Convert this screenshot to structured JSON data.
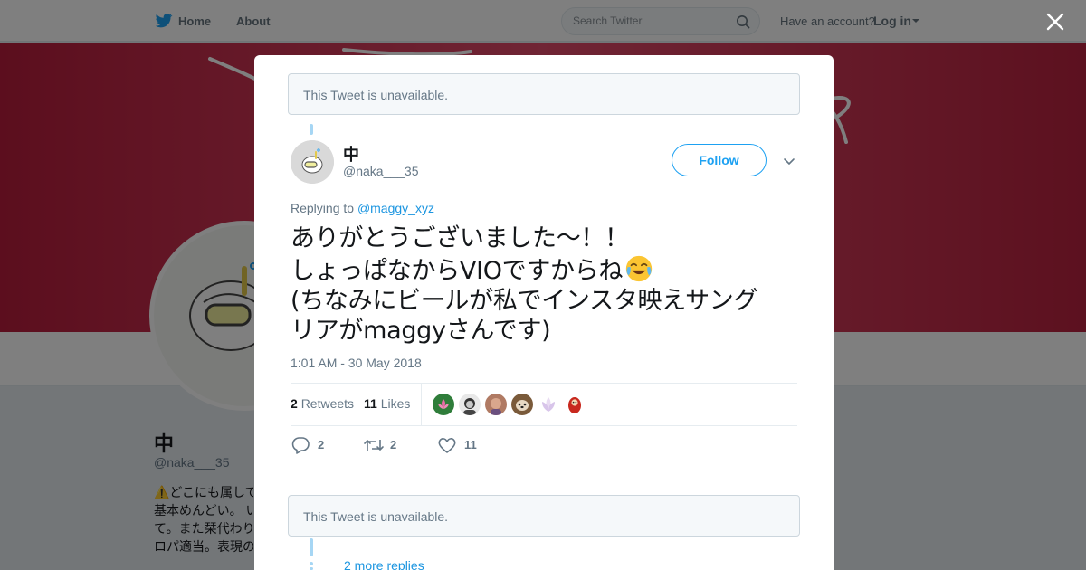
{
  "topbar": {
    "home_label": "Home",
    "about_label": "About",
    "search_placeholder": "Search Twitter",
    "account_prompt": "Have an account?",
    "login_label": "Log in"
  },
  "profile": {
    "name": "中",
    "handle": "@naka___35",
    "bio_lines": [
      "⚠️どこにも属して",
      "基本めんどい。 い",
      "て。また栞代わり",
      "ロパ適当。表現の"
    ]
  },
  "modal": {
    "unavailable_top": "This Tweet is unavailable.",
    "unavailable_bottom": "This Tweet is unavailable.",
    "more_replies": "2 more replies"
  },
  "tweet": {
    "author_name": "中",
    "author_handle": "@naka___35",
    "follow_label": "Follow",
    "replying_prefix": "Replying to",
    "replying_to": "@maggy_xyz",
    "text_lines": [
      "ありがとうございました～！！",
      "しょっぱなからVIOですからね",
      "(ちなみにビールが私でインスタ映えサング",
      "リアがmaggyさんです)"
    ],
    "emoji": "face-with-tears-of-joy",
    "timestamp": "1:01 AM - 30 May 2018",
    "retweets_count": "2",
    "retweets_label": "Retweets",
    "likes_count": "11",
    "likes_label": "Likes",
    "likers_count": 6,
    "reply_count": "2",
    "retweet_count": "2",
    "like_count": "11"
  },
  "colors": {
    "accent": "#1da1f2",
    "link": "#1b95e0",
    "banner": "#d63a5c",
    "muted": "#657786",
    "thread_line": "#a6d6f4"
  }
}
